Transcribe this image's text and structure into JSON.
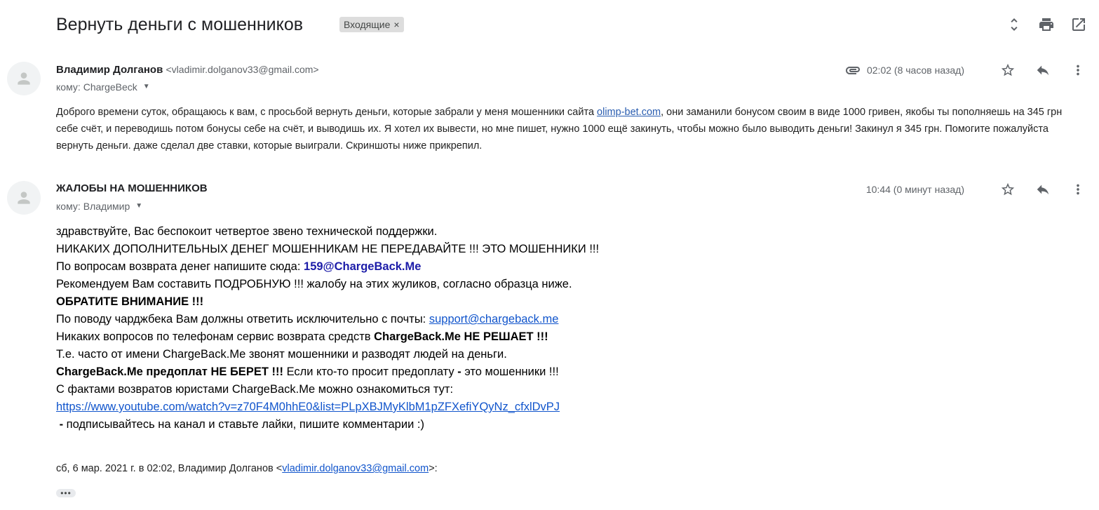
{
  "thread": {
    "subject": "Вернуть деньги с мошенников",
    "label": "Входящие",
    "label_close": "×"
  },
  "toolbar": {
    "icons": [
      "expand-collapse-icon",
      "print-icon",
      "open-new-window-icon"
    ]
  },
  "messages": [
    {
      "sender_name": "Владимир Долганов",
      "sender_email": "<vladimir.dolganov33@gmail.com>",
      "to_prefix": "кому:",
      "to": "ChargeBeck",
      "time": "02:02 (8 часов назад)",
      "has_attachment": true,
      "body_part1": "Доброго времени суток, обращаюсь к вам, с просьбой вернуть деньги, которые забрали у меня мошенники сайта ",
      "body_link": "olimp-bet.com",
      "body_part2": ", они заманили бонусом своим в виде 1000 гривен, якобы ты пополняешь на 345 грн себе счёт, и переводишь потом бонусы себе на счёт, и выводишь их. Я хотел их вывести, но мне пишет, нужно 1000 ещё закинуть, чтобы можно было выводить деньги! Закинул я 345 грн. Помогите пожалуйста вернуть деньги. даже сделал две ставки, которые выиграли. Скриншоты ниже прикрепил."
    },
    {
      "sender_name": "ЖАЛОБЫ НА МОШЕННИКОВ",
      "to_prefix": "кому:",
      "to": "Владимир",
      "time": "10:44 (0 минут назад)",
      "lines": {
        "l1": "здравствуйте, Вас беспокоит четвертое звено технической поддержки.",
        "l2": "НИКАКИХ ДОПОЛНИТЕЛЬНЫХ ДЕНЕГ МОШЕННИКАМ НЕ ПЕРЕДАВАЙТЕ !!! ЭТО МОШЕННИКИ !!!",
        "l3_text": "По вопросам возврата денег напишите сюда: ",
        "l3_email": "159@ChargeBack.Me",
        "l4": "Рекомендуем Вам составить ПОДРОБНУЮ !!! жалобу на этих жуликов, согласно образца ниже.",
        "l5": "ОБРАТИТЕ ВНИМАНИЕ !!!",
        "l6_text": "По поводу чарджбека Вам должны ответить исключительно с почты: ",
        "l6_link": "support@chargeback.me",
        "l7_text": "Никаких вопросов по телефонам сервис возврата средств ",
        "l7_bold": "ChargeBack.Me НЕ РЕШАЕТ !!!",
        "l8": "Т.е. часто от имени ChargeBack.Me звонят мошенники и разводят людей на деньги.",
        "l9_bold": "ChargeBack.Me предоплат НЕ БЕРЕТ !!!",
        "l9_text": " Если кто-то просит предоплату ",
        "l9_dash": "-",
        "l9_tail": " это мошенники !!!",
        "l10": "С фактами возвратов юристами ChargeBack.Me можно ознакомиться тут:",
        "l11_link": "https://www.youtube.com/watch?v=z70F4M0hhE0&list=PLpXBJMyKlbM1pZFXefiYQyNz_cfxlDvPJ",
        "l12_dash": "-",
        "l12_text": " подписывайтесь на канал и ставьте лайки, пишите комментарии :)"
      },
      "quote_prefix": "сб, 6 мар. 2021 г. в 02:02, Владимир Долганов <",
      "quote_email": "vladimir.dolganov33@gmail.com",
      "quote_suffix": ">:",
      "show_trimmed": "•••"
    }
  ]
}
